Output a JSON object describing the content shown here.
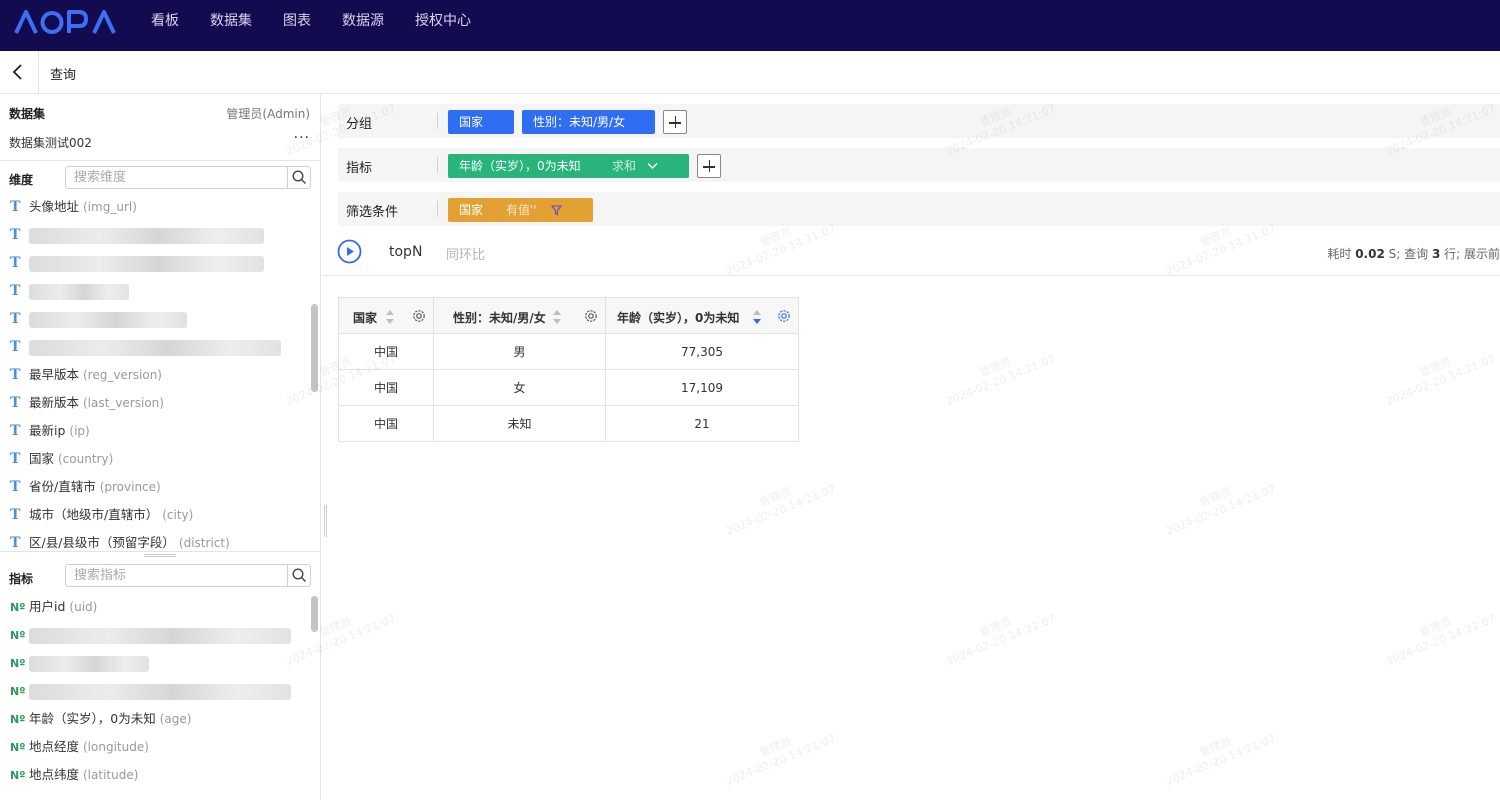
{
  "nav": {
    "logo": "AOPA",
    "items": [
      "看板",
      "数据集",
      "图表",
      "数据源",
      "授权中心"
    ]
  },
  "subheader": {
    "title": "查询"
  },
  "dataset": {
    "label": "数据集",
    "owner": "管理员(Admin)",
    "name": "数据集测试002",
    "more": "···"
  },
  "dimensions": {
    "label": "维度",
    "search_placeholder": "搜索维度",
    "items": [
      {
        "name": "头像地址",
        "code": "(img_url)"
      },
      {
        "name": "",
        "code": ""
      },
      {
        "name": "",
        "code": ""
      },
      {
        "name": "",
        "code": ""
      },
      {
        "name": "",
        "code": ""
      },
      {
        "name": "",
        "code": ""
      },
      {
        "name": "最早版本",
        "code": "(reg_version)"
      },
      {
        "name": "最新版本",
        "code": "(last_version)"
      },
      {
        "name": "最新ip",
        "code": "(ip)"
      },
      {
        "name": "国家",
        "code": "(country)"
      },
      {
        "name": "省份/直辖市",
        "code": "(province)"
      },
      {
        "name": "城市（地级市/直辖市）",
        "code": "(city)"
      },
      {
        "name": "区/县/县级市（预留字段）",
        "code": "(district)"
      }
    ]
  },
  "metrics": {
    "label": "指标",
    "search_placeholder": "搜索指标",
    "items": [
      {
        "name": "用户id",
        "code": "(uid)"
      },
      {
        "name": "",
        "code": ""
      },
      {
        "name": "",
        "code": ""
      },
      {
        "name": "",
        "code": ""
      },
      {
        "name": "年龄（实岁），0为未知",
        "code": "(age)"
      },
      {
        "name": "地点经度",
        "code": "(longitude)"
      },
      {
        "name": "地点纬度",
        "code": "(latitude)"
      }
    ]
  },
  "query": {
    "group_label": "分组",
    "group_chips": [
      "国家",
      "性别：未知/男/女"
    ],
    "metric_label": "指标",
    "metric_chip": {
      "name": "年龄（实岁），0为未知",
      "agg": "求和"
    },
    "filter_label": "筛选条件",
    "filter_chip": {
      "name": "国家",
      "cond": "有值''"
    },
    "topn": "topN",
    "yoy": "同环比",
    "status": {
      "prefix": "耗时",
      "time": "0.02",
      "mid": "S; 查询",
      "rows": "3",
      "suffix": "行; 展示前"
    }
  },
  "table": {
    "headers": [
      "国家",
      "性别：未知/男/女",
      "年龄（实岁），0为未知"
    ],
    "rows": [
      [
        "中国",
        "男",
        "77,305"
      ],
      [
        "中国",
        "女",
        "17,109"
      ],
      [
        "中国",
        "未知",
        "21"
      ]
    ]
  },
  "watermark": {
    "user": "管理员",
    "time": "2024-02-20 14:21:07"
  },
  "colors": {
    "nav_bg": "#130b4f",
    "accent_blue": "#2f6df2",
    "accent_green": "#28b47b",
    "accent_orange": "#e3a033"
  }
}
